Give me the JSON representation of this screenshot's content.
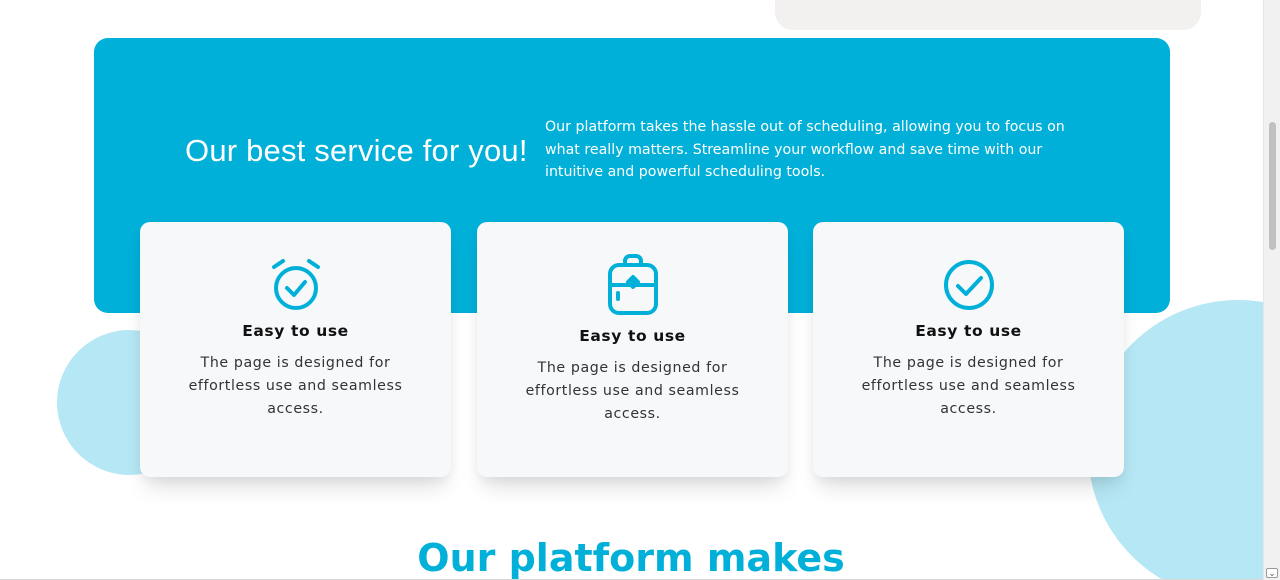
{
  "colors": {
    "accent": "#00b0d8",
    "blob": "#b6e7f5",
    "card_bg": "#f6f8fa"
  },
  "banner": {
    "heading": "Our best service for you!",
    "description": "Our platform takes the hassle out of scheduling, allowing you to focus on what really matters. Streamline your workflow and save time with our intuitive and powerful scheduling tools."
  },
  "cards": [
    {
      "icon": "alarm-clock-check-icon",
      "title": "Easy to use",
      "text": "The page is designed for effortless use and seamless access."
    },
    {
      "icon": "backpack-icon",
      "title": "Easy to use",
      "text": "The page is designed for effortless use and seamless access."
    },
    {
      "icon": "check-circle-icon",
      "title": "Easy to use",
      "text": "The page is designed for effortless use and seamless access."
    }
  ],
  "section": {
    "heading": "Our platform makes"
  }
}
